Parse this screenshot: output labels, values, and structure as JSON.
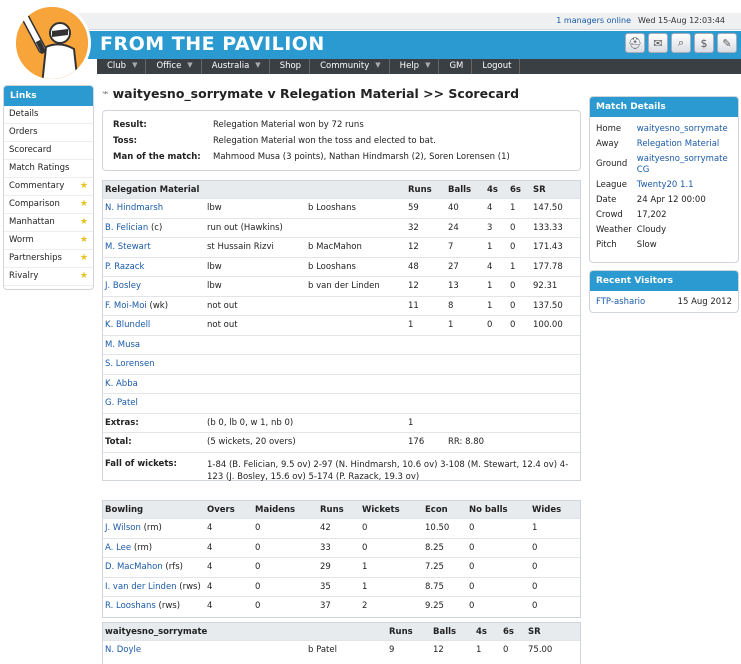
{
  "header": {
    "online": "1 managers online",
    "clock": "Wed 15-Aug 12:03:44",
    "logo_text": "FROM THE PAVILION",
    "icons": [
      "helmet-icon",
      "mail-icon",
      "search-icon",
      "money-icon",
      "attach-icon"
    ],
    "menu": [
      {
        "label": "Club",
        "caret": true
      },
      {
        "label": "Office",
        "caret": true
      },
      {
        "label": "Australia",
        "caret": true
      },
      {
        "label": "Shop",
        "caret": false
      },
      {
        "label": "Community",
        "caret": true
      },
      {
        "label": "Help",
        "caret": true
      },
      {
        "label": "GM",
        "caret": false
      },
      {
        "label": "Logout",
        "caret": false
      }
    ]
  },
  "links": {
    "title": "Links",
    "items": [
      {
        "label": "Details",
        "star": false
      },
      {
        "label": "Orders",
        "star": false
      },
      {
        "label": "Scorecard",
        "star": false
      },
      {
        "label": "Match Ratings",
        "star": false
      },
      {
        "label": "Commentary",
        "star": true
      },
      {
        "label": "Comparison",
        "star": true
      },
      {
        "label": "Manhattan",
        "star": true
      },
      {
        "label": "Worm",
        "star": true
      },
      {
        "label": "Partnerships",
        "star": true
      },
      {
        "label": "Rivalry",
        "star": true
      }
    ]
  },
  "page_title": "waityesno_sorrymate v Relegation Material >> Scorecard",
  "result": {
    "rows": [
      {
        "k": "Result:",
        "v": "Relegation Material won by 72 runs"
      },
      {
        "k": "Toss:",
        "v": "Relegation Material won the toss and elected to bat."
      },
      {
        "k": "Man of the match:",
        "v": "Mahmood Musa (3 points), Nathan Hindmarsh (2), Soren Lorensen (1)"
      }
    ]
  },
  "batting1": {
    "team": "Relegation Material",
    "headers": {
      "runs": "Runs",
      "balls": "Balls",
      "fours": "4s",
      "sixes": "6s",
      "sr": "SR"
    },
    "rows": [
      {
        "name": "N. Hindmarsh",
        "how": "lbw",
        "bowler": "b Looshans",
        "runs": "59",
        "balls": "40",
        "fours": "4",
        "sixes": "1",
        "sr": "147.50"
      },
      {
        "name": "B. Felician",
        "suffix": " (c)",
        "how": "run out (Hawkins)",
        "bowler": "",
        "runs": "32",
        "balls": "24",
        "fours": "3",
        "sixes": "0",
        "sr": "133.33"
      },
      {
        "name": "M. Stewart",
        "how": "st Hussain Rizvi",
        "bowler": "b MacMahon",
        "runs": "12",
        "balls": "7",
        "fours": "1",
        "sixes": "0",
        "sr": "171.43"
      },
      {
        "name": "P. Razack",
        "how": "lbw",
        "bowler": "b Looshans",
        "runs": "48",
        "balls": "27",
        "fours": "4",
        "sixes": "1",
        "sr": "177.78"
      },
      {
        "name": "J. Bosley",
        "how": "lbw",
        "bowler": "b van der Linden",
        "runs": "12",
        "balls": "13",
        "fours": "1",
        "sixes": "0",
        "sr": "92.31"
      },
      {
        "name": "F. Moi-Moi",
        "suffix": " (wk)",
        "how": "not out",
        "bowler": "",
        "runs": "11",
        "balls": "8",
        "fours": "1",
        "sixes": "0",
        "sr": "137.50"
      },
      {
        "name": "K. Blundell",
        "how": "not out",
        "bowler": "",
        "runs": "1",
        "balls": "1",
        "fours": "0",
        "sixes": "0",
        "sr": "100.00"
      },
      {
        "name": "M. Musa",
        "how": "",
        "bowler": "",
        "runs": "",
        "balls": "",
        "fours": "",
        "sixes": "",
        "sr": ""
      },
      {
        "name": "S. Lorensen",
        "how": "",
        "bowler": "",
        "runs": "",
        "balls": "",
        "fours": "",
        "sixes": "",
        "sr": ""
      },
      {
        "name": "K. Abba",
        "how": "",
        "bowler": "",
        "runs": "",
        "balls": "",
        "fours": "",
        "sixes": "",
        "sr": ""
      },
      {
        "name": "G. Patel",
        "how": "",
        "bowler": "",
        "runs": "",
        "balls": "",
        "fours": "",
        "sixes": "",
        "sr": ""
      }
    ],
    "extras_label": "Extras:",
    "extras_detail": "(b 0, lb 0, w 1, nb 0)",
    "extras_value": "1",
    "total_label": "Total:",
    "total_detail": "(5 wickets, 20 overs)",
    "total_value": "176",
    "total_rr": "RR: 8.80",
    "fow_label": "Fall of wickets:",
    "fow": "1-84 (B. Felician, 9.5 ov) 2-97 (N. Hindmarsh, 10.6 ov) 3-108 (M. Stewart, 12.4 ov) 4-123 (J. Bosley, 15.6 ov) 5-174 (P. Razack, 19.3 ov)"
  },
  "bowling": {
    "headers": {
      "name": "Bowling",
      "overs": "Overs",
      "maidens": "Maidens",
      "runs": "Runs",
      "wickets": "Wickets",
      "econ": "Econ",
      "noballs": "No balls",
      "wides": "Wides"
    },
    "rows": [
      {
        "name": "J. Wilson",
        "suffix": " (rm)",
        "overs": "4",
        "maidens": "0",
        "runs": "42",
        "wickets": "0",
        "econ": "10.50",
        "noballs": "0",
        "wides": "1"
      },
      {
        "name": "A. Lee",
        "suffix": " (rm)",
        "overs": "4",
        "maidens": "0",
        "runs": "33",
        "wickets": "0",
        "econ": "8.25",
        "noballs": "0",
        "wides": "0"
      },
      {
        "name": "D. MacMahon",
        "suffix": " (rfs)",
        "overs": "4",
        "maidens": "0",
        "runs": "29",
        "wickets": "1",
        "econ": "7.25",
        "noballs": "0",
        "wides": "0"
      },
      {
        "name": "I. van der Linden",
        "suffix": " (rws)",
        "overs": "4",
        "maidens": "0",
        "runs": "35",
        "wickets": "1",
        "econ": "8.75",
        "noballs": "0",
        "wides": "0"
      },
      {
        "name": "R. Looshans",
        "suffix": " (rws)",
        "overs": "4",
        "maidens": "0",
        "runs": "37",
        "wickets": "2",
        "econ": "9.25",
        "noballs": "0",
        "wides": "0"
      }
    ]
  },
  "batting2": {
    "team": "waityesno_sorrymate",
    "headers": {
      "runs": "Runs",
      "balls": "Balls",
      "fours": "4s",
      "sixes": "6s",
      "sr": "SR"
    },
    "rows": [
      {
        "name": "N. Doyle",
        "how": "",
        "bowler": "b Patel",
        "runs": "9",
        "balls": "12",
        "fours": "1",
        "sixes": "0",
        "sr": "75.00"
      }
    ]
  },
  "match_details": {
    "title": "Match Details",
    "rows": [
      {
        "k": "Home",
        "v": "waityesno_sorrymate",
        "link": true
      },
      {
        "k": "Away",
        "v": "Relegation Material",
        "link": true
      },
      {
        "k": "Ground",
        "v": "waityesno_sorrymate CG",
        "link": true
      },
      {
        "k": "League",
        "v": "Twenty20 1.1",
        "link": true
      },
      {
        "k": "Date",
        "v": "24 Apr 12 00:00",
        "link": false
      },
      {
        "k": "Crowd",
        "v": "17,202",
        "link": false
      },
      {
        "k": "Weather",
        "v": "Cloudy",
        "link": false
      },
      {
        "k": "Pitch",
        "v": "Slow",
        "link": false
      }
    ]
  },
  "recent_visitors": {
    "title": "Recent Visitors",
    "rows": [
      {
        "name": "FTP-ashario",
        "date": "15 Aug 2012"
      }
    ]
  }
}
